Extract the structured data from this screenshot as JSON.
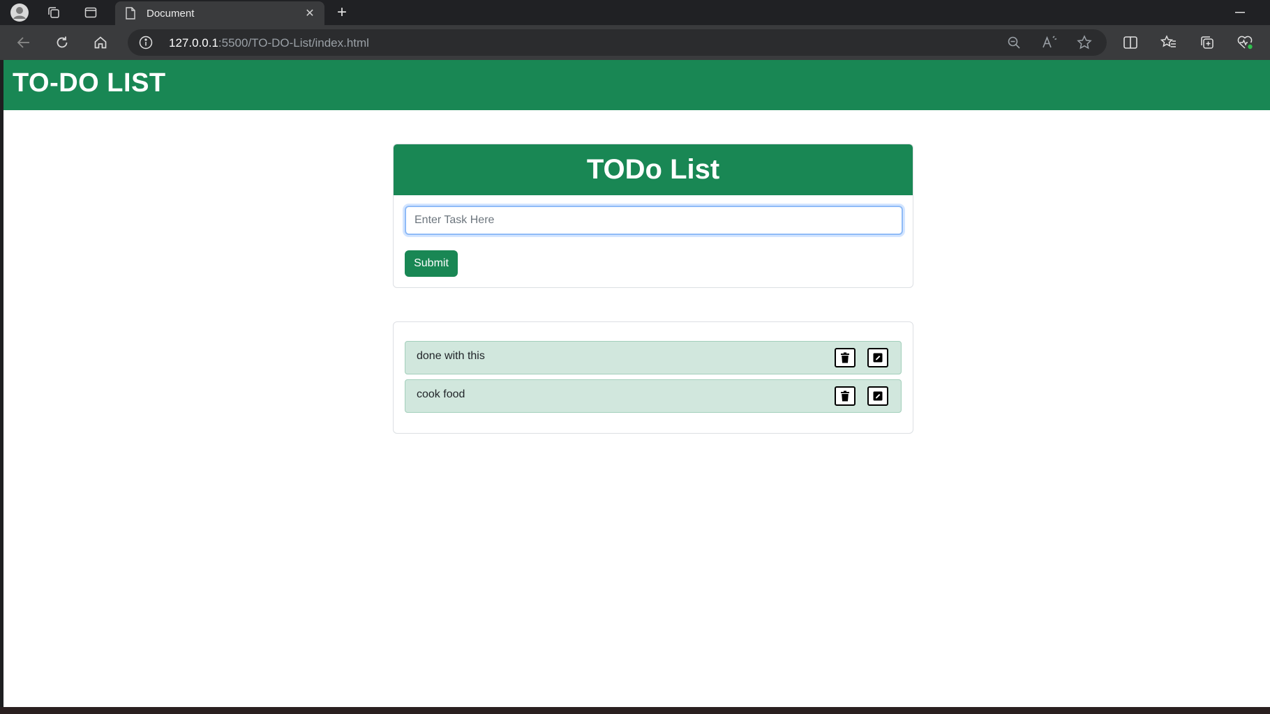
{
  "browser": {
    "tab_title": "Document",
    "url_host": "127.0.0.1",
    "url_path": ":5500/TO-DO-List/index.html"
  },
  "page": {
    "header_title": "TO-DO LIST",
    "card_title": "TODo List",
    "input": {
      "placeholder": "Enter Task Here",
      "value": ""
    },
    "submit_label": "Submit",
    "tasks": [
      {
        "text": "done with this"
      },
      {
        "text": "cook food"
      }
    ]
  },
  "colors": {
    "brand_green": "#198754",
    "task_bg": "#d1e7dd",
    "chrome_dark": "#202124"
  },
  "icons": {
    "delete": "trash-icon",
    "edit": "edit-icon"
  }
}
